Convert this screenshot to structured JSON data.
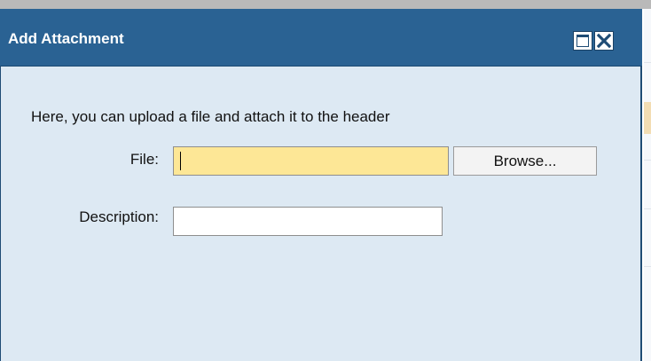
{
  "dialog": {
    "title": "Add Attachment",
    "intro_text": "Here, you can upload a file and attach it to the header",
    "file_label": "File:",
    "file_value": "",
    "browse_label": "Browse...",
    "description_label": "Description:",
    "description_value": ""
  },
  "icons": {
    "maximize": "maximize-icon",
    "close": "close-icon"
  },
  "colors": {
    "titlebar": "#2a6293",
    "dialog_background": "#dde9f3",
    "file_field_highlight": "#fde796"
  }
}
